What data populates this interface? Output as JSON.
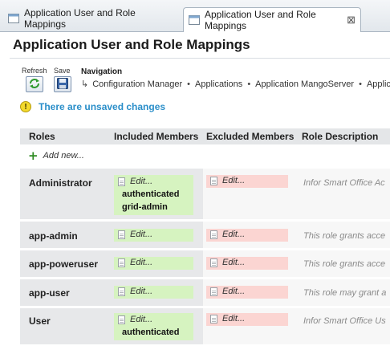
{
  "tabs": [
    {
      "label": "Application User and Role Mappings",
      "active": false
    },
    {
      "label": "Application User and Role Mappings",
      "active": true
    }
  ],
  "page": {
    "title": "Application User and Role Mappings"
  },
  "toolbar": {
    "refresh_label": "Refresh",
    "save_label": "Save"
  },
  "navigation": {
    "label": "Navigation",
    "breadcrumb": [
      "Configuration Manager",
      "Applications",
      "Application MangoServer",
      "Applic"
    ]
  },
  "warning": {
    "text": "There are unsaved changes"
  },
  "table": {
    "headers": [
      "Roles",
      "Included Members",
      "Excluded Members",
      "Role Description"
    ],
    "add_label": "Add new...",
    "edit_label": "Edit...",
    "rows": [
      {
        "role": "Administrator",
        "included_members": [
          "authenticated",
          "grid-admin"
        ],
        "description": "Infor Smart Office Ac"
      },
      {
        "role": "app-admin",
        "included_members": [],
        "description": "This role grants acce"
      },
      {
        "role": "app-poweruser",
        "included_members": [],
        "description": "This role grants acce"
      },
      {
        "role": "app-user",
        "included_members": [],
        "description": "This role may grant a"
      },
      {
        "role": "User",
        "included_members": [
          "authenticated"
        ],
        "description": "Infor Smart Office Us"
      }
    ]
  },
  "colors": {
    "accent": "#2a8ec9",
    "included_bg": "#d6f3c0",
    "excluded_bg": "#fbd5d2",
    "warning": "#f3d92b"
  }
}
